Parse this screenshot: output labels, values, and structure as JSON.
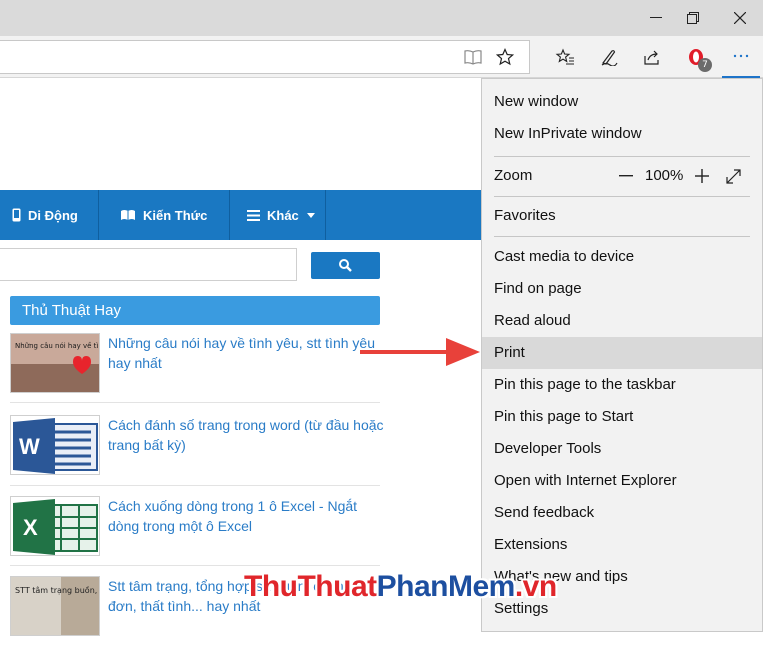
{
  "browser": {
    "toolbar_icons": [
      "reading-view-icon",
      "favorite-star-icon",
      "favorites-hub-icon",
      "web-note-icon",
      "share-icon",
      "opera-extension-icon",
      "more-icon"
    ],
    "extension_badge": "7"
  },
  "website": {
    "nav": [
      {
        "icon": "mobile-icon",
        "label": "Di Động"
      },
      {
        "icon": "book-icon",
        "label": "Kiến Thức"
      },
      {
        "icon": "list-icon",
        "label": "Khác"
      }
    ],
    "search": {
      "placeholder": ""
    },
    "widget_title": "Thủ Thuật Hay",
    "posts": [
      {
        "title": "Những câu nói hay về tình yêu, stt tình yêu hay nhất",
        "thumb_text": "Những câu nói hay về tình yêu"
      },
      {
        "title": "Cách đánh số trang trong word (từ đầu hoặc trang bất kỳ)",
        "thumb_text": "W"
      },
      {
        "title": "Cách xuống dòng trong 1 ô Excel - Ngắt dòng trong một ô Excel",
        "thumb_text": "X"
      },
      {
        "title": "Stt tâm trạng, tổng hợp stt buồn, chán, cô đơn, thất tình... hay nhất",
        "thumb_text": "STT tâm trạng buồn, chán, cô đơn, thất tình..."
      }
    ]
  },
  "menu": {
    "items": [
      "New window",
      "New InPrivate window",
      "Zoom",
      "Favorites",
      "Cast media to device",
      "Find on page",
      "Read aloud",
      "Print",
      "Pin this page to the taskbar",
      "Pin this page to Start",
      "Developer Tools",
      "Open with Internet Explorer",
      "Send feedback",
      "Extensions",
      "What's new and tips",
      "Settings"
    ],
    "zoom_value": "100%",
    "highlighted": "Print"
  },
  "watermark": {
    "part1": "ThuThuat",
    "part2": "PhanMem",
    "part3": ".vn"
  },
  "colors": {
    "accent": "#1a78c2",
    "menu_bg": "#f2f2f2",
    "highlight": "#d9d9d9",
    "arrow": "#e8413a"
  }
}
